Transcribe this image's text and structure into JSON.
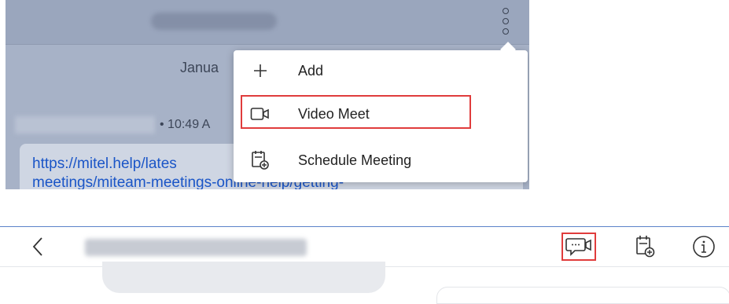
{
  "top_screenshot": {
    "date_label": "Janua",
    "time_label": "• 10:49 A",
    "link_line1": "https://mitel.help/lates",
    "link_line2": "meetings/miteam-meetings-online-help/getting-"
  },
  "menu": {
    "items": [
      {
        "label": "Add",
        "icon": "plus-icon"
      },
      {
        "label": "Video Meet",
        "icon": "video-camera-icon"
      },
      {
        "label": "Schedule Meeting",
        "icon": "calendar-add-icon"
      }
    ]
  },
  "bottom_bar": {
    "back_icon": "chevron-left-icon",
    "actions": [
      {
        "name": "video-meet",
        "icon": "chat-video-icon"
      },
      {
        "name": "schedule-meeting",
        "icon": "calendar-add-icon"
      },
      {
        "name": "info",
        "icon": "info-icon"
      }
    ]
  },
  "colors": {
    "highlight": "#e03c3c",
    "link": "#1a55c7",
    "divider": "#5b83c9"
  }
}
